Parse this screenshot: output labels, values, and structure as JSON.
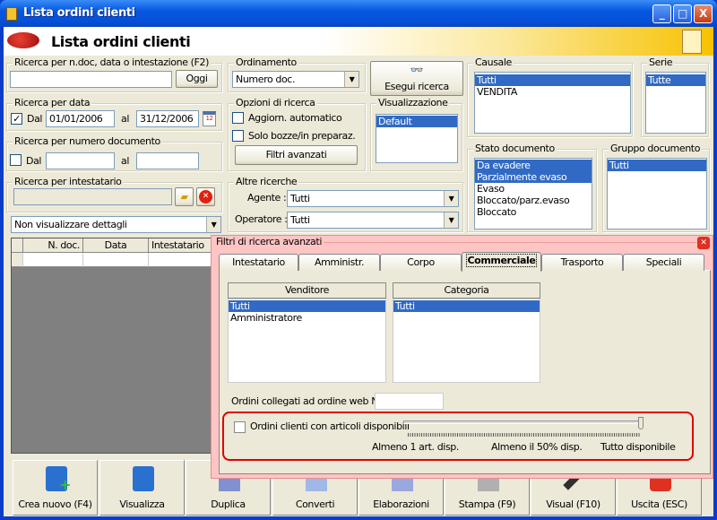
{
  "window": {
    "title": "Lista ordini clienti",
    "header_title": "Lista ordini clienti",
    "min": "_",
    "max": "□",
    "close": "X"
  },
  "search_text": {
    "label": "Ricerca per n.doc, data o intestazione (F2)",
    "value": "",
    "today_button": "Oggi"
  },
  "search_date": {
    "label": "Ricerca per data",
    "checked": true,
    "from_label": "Dal",
    "from": "01/01/2006",
    "to_label": "al",
    "to": "31/12/2006"
  },
  "search_number": {
    "label": "Ricerca per numero documento",
    "checked": false,
    "from_label": "Dal",
    "from": "",
    "to_label": "al",
    "to": ""
  },
  "search_holder": {
    "label": "Ricerca per intestatario",
    "value": ""
  },
  "details_select": "Non visualizzare dettagli",
  "grid": {
    "columns": [
      "N. doc.",
      "Data",
      "Intestatario"
    ]
  },
  "ordering": {
    "label": "Ordinamento",
    "value": "Numero doc."
  },
  "run_search": "Esegui ricerca",
  "options": {
    "label": "Opzioni di ricerca",
    "auto_update": "Aggiorn. automatico",
    "drafts_only": "Solo bozze/in preparaz.",
    "advanced_button": "Filtri avanzati"
  },
  "view": {
    "label": "Visualizzazione",
    "items": [
      "Default"
    ]
  },
  "other": {
    "label": "Altre ricerche",
    "agent_label": "Agente :",
    "agent": "Tutti",
    "operator_label": "Operatore :",
    "operator": "Tutti"
  },
  "causale": {
    "label": "Causale",
    "items": [
      "Tutti",
      "VENDITA"
    ]
  },
  "serie": {
    "label": "Serie",
    "items": [
      "Tutte"
    ]
  },
  "stato": {
    "label": "Stato documento",
    "items": [
      "Da evadere",
      "Parzialmente evaso",
      "Evaso",
      "Bloccato/parz.evaso",
      "Bloccato"
    ]
  },
  "gruppo": {
    "label": "Gruppo documento",
    "items": [
      "Tutti"
    ]
  },
  "toolbar": [
    "Crea nuovo (F4)",
    "Visualizza",
    "Duplica",
    "Converti",
    "Elaborazioni",
    "Stampa (F9)",
    "Visual (F10)",
    "Uscita (ESC)"
  ],
  "dialog": {
    "title": "Filtri di ricerca avanzati",
    "tabs": [
      "Intestatario",
      "Amministr.",
      "Corpo",
      "Commerciale",
      "Trasporto",
      "Speciali"
    ],
    "active_tab": "Commerciale",
    "seller": {
      "header": "Venditore",
      "items": [
        "Tutti",
        "Amministratore"
      ]
    },
    "category": {
      "header": "Categoria",
      "items": [
        "Tutti"
      ]
    },
    "web_order_label": "Ordini collegati ad ordine web N.",
    "web_order_value": "",
    "available_label": "Ordini clienti con articoli disponibili",
    "available_checked": false,
    "slider_value_percent": 100,
    "slider_labels": [
      "Almeno 1 art. disp.",
      "Almeno il 50% disp.",
      "Tutto disponibile"
    ]
  }
}
